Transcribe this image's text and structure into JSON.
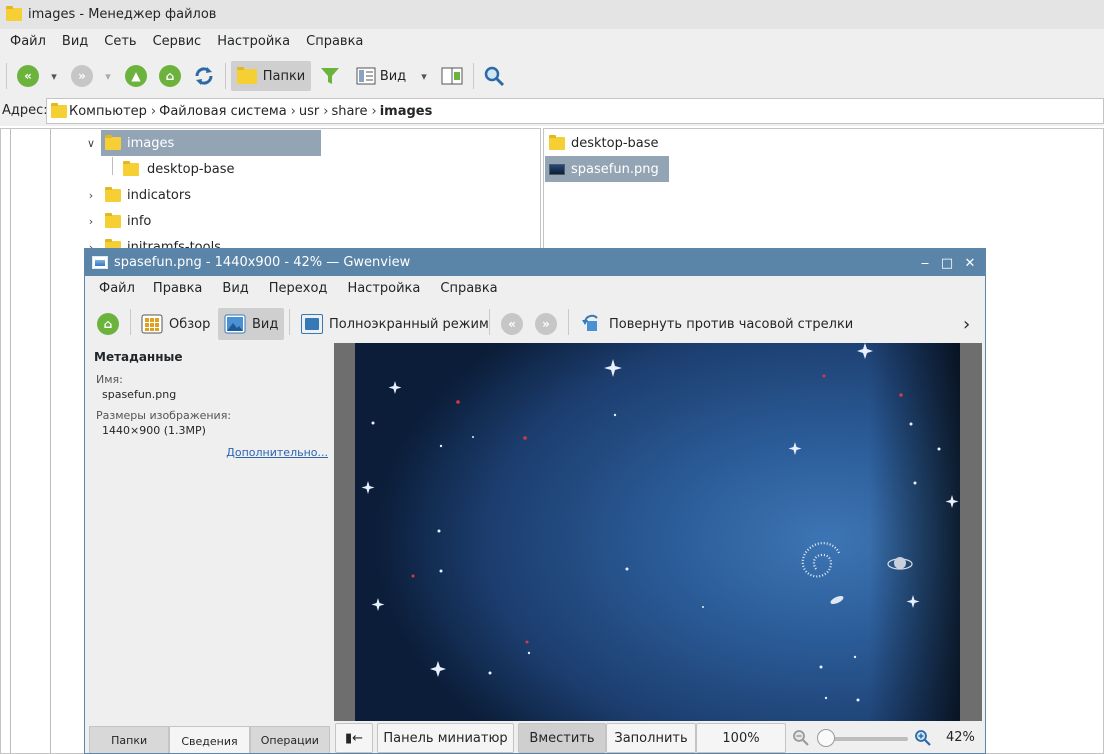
{
  "file_manager": {
    "title": "images - Менеджер файлов",
    "menu": [
      "Файл",
      "Вид",
      "Сеть",
      "Сервис",
      "Настройка",
      "Справка"
    ],
    "toolbar": {
      "folders_label": "Папки",
      "view_label": "Вид"
    },
    "address": {
      "label": "Адрес:",
      "crumbs": [
        "Компьютер",
        "Файловая система",
        "usr",
        "share",
        "images"
      ]
    },
    "tree": [
      {
        "label": "images",
        "state": "expanded",
        "selected": true
      },
      {
        "label": "desktop-base",
        "state": "leaf",
        "selected": false
      },
      {
        "label": "indicators",
        "state": "collapsed",
        "selected": false
      },
      {
        "label": "info",
        "state": "collapsed",
        "selected": false
      },
      {
        "label": "initramfs-tools",
        "state": "collapsed",
        "selected": false
      }
    ],
    "files": [
      {
        "label": "desktop-base",
        "kind": "folder",
        "selected": false
      },
      {
        "label": "spasefun.png",
        "kind": "image",
        "selected": true
      }
    ]
  },
  "gwenview": {
    "title": "spasefun.png - 1440x900 - 42%  — Gwenview",
    "menu": [
      "Файл",
      "Правка",
      "Вид",
      "Переход",
      "Настройка",
      "Справка"
    ],
    "toolbar": {
      "browse_label": "Обзор",
      "view_label": "Вид",
      "fullscreen_label": "Полноэкранный режим",
      "rotate_label": "Повернуть против часовой стрелки"
    },
    "sidebar": {
      "heading": "Метаданные",
      "name_label": "Имя:",
      "name_value": "spasefun.png",
      "size_label": "Размеры изображения:",
      "size_value": "1440×900 (1.3MP)",
      "more_link": "Дополнительно..."
    },
    "tabs": [
      "Папки",
      "Сведения",
      "Операции"
    ],
    "active_tab": "Сведения",
    "bottom": {
      "toggle_label": "▮←",
      "thumbnails_label": "Панель миниатюр",
      "fit_label": "Вместить",
      "fill_label": "Заполнить",
      "hundred_label": "100%",
      "zoom_value": "42%"
    }
  },
  "colors": {
    "selection": "#93a4b5",
    "gwenview_title": "#5b84a9",
    "icon_green": "#6bb33c",
    "folder_yellow": "#f6cf35"
  }
}
